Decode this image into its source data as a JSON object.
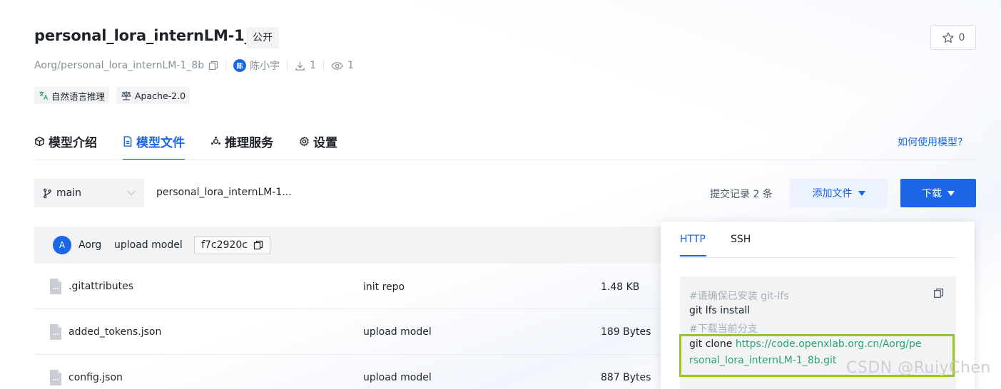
{
  "header": {
    "title": "personal_lora_internLM-1_8b",
    "visibility": "公开",
    "stars": "0",
    "repo_path": "Aorg/personal_lora_internLM-1_8b",
    "owner_initial": "陈",
    "owner": "陈小宇",
    "downloads": "1",
    "views": "1",
    "tags": [
      "自然语言推理",
      "Apache-2.0"
    ]
  },
  "tabs": [
    {
      "label": "模型介绍",
      "icon": "cube-icon"
    },
    {
      "label": "模型文件",
      "icon": "file-icon"
    },
    {
      "label": "推理服务",
      "icon": "service-icon"
    },
    {
      "label": "设置",
      "icon": "gear-icon"
    }
  ],
  "active_tab": "模型文件",
  "howto_link": "如何使用模型?",
  "toolbar": {
    "branch": "main",
    "breadcrumb": "personal_lora_internLM-1...",
    "commits": "提交记录 2 条",
    "add_file": "添加文件",
    "download": "下载"
  },
  "commit": {
    "avatar_initial": "A",
    "author": "Aorg",
    "message": "upload model",
    "hash": "f7c2920c"
  },
  "files": [
    {
      "name": ".gitattributes",
      "message": "init repo",
      "size": "1.48 KB"
    },
    {
      "name": "added_tokens.json",
      "message": "upload model",
      "size": "189 Bytes"
    },
    {
      "name": "config.json",
      "message": "upload model",
      "size": "887 Bytes"
    }
  ],
  "download_popover": {
    "tabs": [
      "HTTP",
      "SSH"
    ],
    "active_tab": "HTTP",
    "lines": [
      {
        "type": "comment",
        "text": "#请确保已安装 git-lfs"
      },
      {
        "type": "command",
        "text": "git lfs install"
      },
      {
        "type": "comment",
        "text": "#下载当前分支"
      }
    ],
    "clone_prefix": "git clone ",
    "clone_url_line1": "https://code.openxlab.org.cn/Aorg/pe",
    "clone_url_line2": "rsonal_lora_internLM-1_8b.git"
  },
  "watermark": "CSDN @RuiyChen",
  "colors": {
    "accent": "#1a66e6",
    "link_green": "#2ba471",
    "highlight_border": "#9ac421"
  }
}
